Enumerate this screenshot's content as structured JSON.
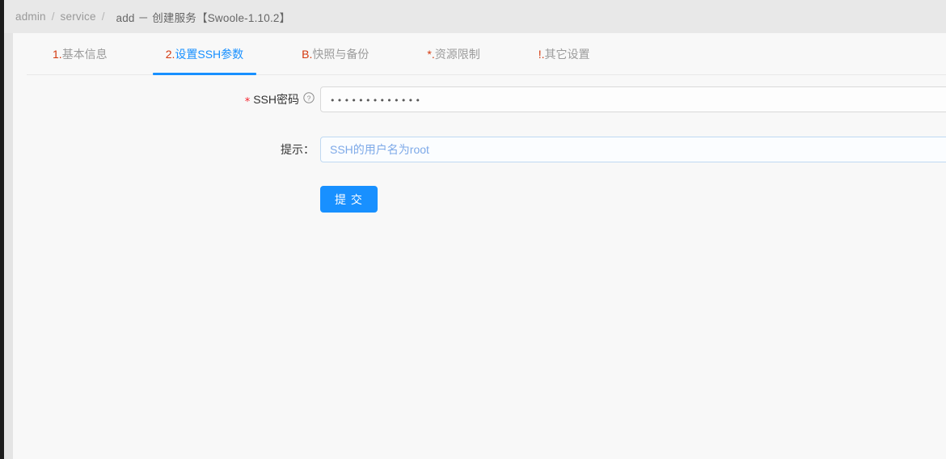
{
  "breadcrumb": {
    "items": [
      {
        "label": "admin",
        "type": "link"
      },
      {
        "label": "service",
        "type": "link"
      }
    ],
    "separator": "/",
    "current": "add － 创建服务【Swoole-1.10.2】"
  },
  "tabs": [
    {
      "prefix": "1.",
      "label": "基本信息",
      "active": false,
      "name": "tab-basic-info"
    },
    {
      "prefix": "2.",
      "label": "设置SSH参数",
      "active": true,
      "name": "tab-ssh-params"
    },
    {
      "prefix": "B.",
      "label": "快照与备份",
      "active": false,
      "name": "tab-snapshot-backup"
    },
    {
      "prefix": "*.",
      "label": "资源限制",
      "active": false,
      "name": "tab-resource-limit"
    },
    {
      "prefix": "!.",
      "label": "其它设置",
      "active": false,
      "name": "tab-other-settings"
    }
  ],
  "form": {
    "ssh_password": {
      "label": "SSH密码",
      "required_mark": "*",
      "help_icon": "question-circle-icon",
      "value": "•••••••••••••",
      "placeholder": "",
      "masked_char_count": 13
    },
    "hint": {
      "label": "提示：",
      "value": "SSH的用户名为root",
      "placeholder": "SSH的用户名为root"
    },
    "submit_label": "提 交"
  },
  "colors": {
    "accent_blue": "#1890ff",
    "prefix_orange": "#d4380d",
    "required_red": "#f5222d",
    "hint_text_blue": "#7da9e8",
    "hint_border_blue": "#bfd9f2",
    "page_bg": "#e4e4e4",
    "card_bg": "#f8f8f8",
    "breadcrumb_bg": "#e8e8e8"
  }
}
